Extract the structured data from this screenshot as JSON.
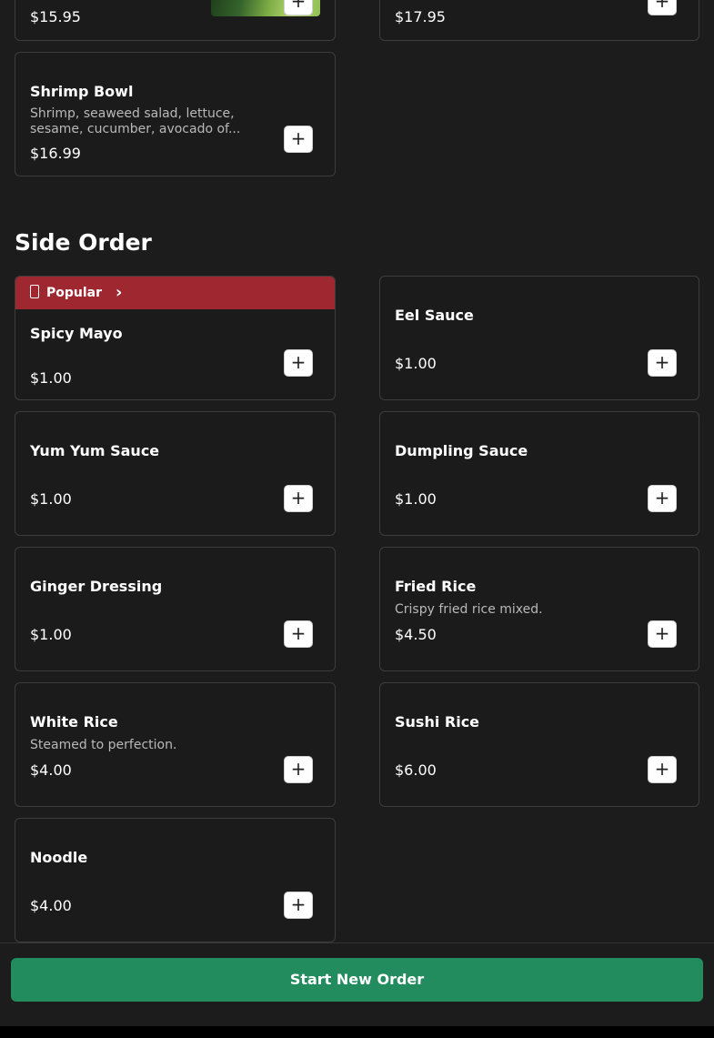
{
  "top_items": [
    {
      "price": "$15.95"
    },
    {
      "price": "$17.95"
    }
  ],
  "shrimp_bowl": {
    "name": "Shrimp Bowl",
    "description_line1": "Shrimp, seaweed salad, lettuce,",
    "description_line2": "sesame, cucumber, avocado of...",
    "price": "$16.99"
  },
  "add_label": "+",
  "section": {
    "title": "Side Order"
  },
  "badge": {
    "label": "Popular",
    "icon": "fire-icon",
    "chevron": "›"
  },
  "side_items": [
    {
      "name": "Spicy Mayo",
      "description": "",
      "price": "$1.00",
      "popular": true
    },
    {
      "name": "Eel Sauce",
      "description": "",
      "price": "$1.00"
    },
    {
      "name": "Yum Yum Sauce",
      "description": "",
      "price": "$1.00"
    },
    {
      "name": "Dumpling Sauce",
      "description": "",
      "price": "$1.00"
    },
    {
      "name": "Ginger Dressing",
      "description": "",
      "price": "$1.00"
    },
    {
      "name": "Fried Rice",
      "description": "Crispy fried rice mixed.",
      "price": "$4.50"
    },
    {
      "name": "White Rice",
      "description": "Steamed to perfection.",
      "price": "$4.00"
    },
    {
      "name": "Sushi Rice",
      "description": "",
      "price": "$6.00"
    },
    {
      "name": "Noodle",
      "description": "",
      "price": "$4.00"
    }
  ],
  "footer": {
    "button_label": "Start New Order"
  },
  "colors": {
    "background": "#1c1c1c",
    "accent": "#238c5e",
    "badge": "#9e2730"
  }
}
